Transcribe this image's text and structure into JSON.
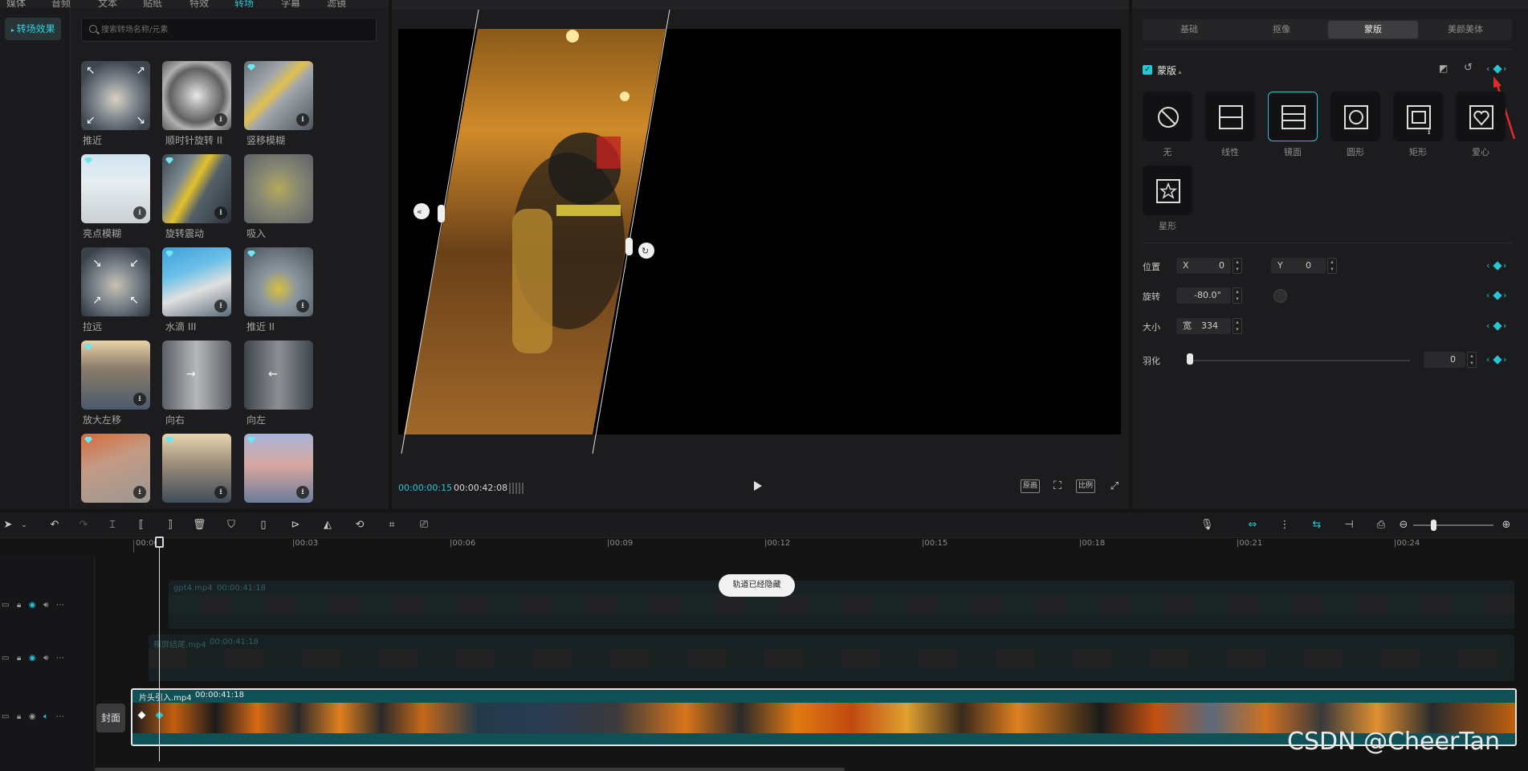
{
  "top_nav": {
    "items": [
      {
        "label": "媒体",
        "active": false
      },
      {
        "label": "音频",
        "active": false
      },
      {
        "label": "文本",
        "active": false
      },
      {
        "label": "贴纸",
        "active": false
      },
      {
        "label": "特效",
        "active": false
      },
      {
        "label": "转场",
        "active": true
      },
      {
        "label": "字幕",
        "active": false
      },
      {
        "label": "滤镜",
        "active": false
      }
    ]
  },
  "left_panel": {
    "category": "转场效果",
    "search_placeholder": "搜索转场名称/元素",
    "tiles": [
      {
        "label": "推近",
        "icon": "zoom-in-arrows",
        "download": false
      },
      {
        "label": "顺时针旋转 II",
        "icon": "spin-blur",
        "download": true
      },
      {
        "label": "竖移模糊",
        "icon": "vertical-blur",
        "download": true
      },
      {
        "label": "亮点模糊",
        "icon": "light-blur",
        "download": true
      },
      {
        "label": "旋转震动",
        "icon": "rotate-shake",
        "download": true
      },
      {
        "label": "吸入",
        "icon": "suck-in",
        "download": false
      },
      {
        "label": "拉远",
        "icon": "zoom-out-arrows",
        "download": false
      },
      {
        "label": "水滴 III",
        "icon": "water-drop",
        "download": true
      },
      {
        "label": "推近 II",
        "icon": "push-in",
        "download": true
      },
      {
        "label": "放大左移",
        "icon": "zoom-left",
        "download": true
      },
      {
        "label": "向右",
        "icon": "move-right",
        "download": false
      },
      {
        "label": "向左",
        "icon": "move-left",
        "download": false
      },
      {
        "label": "",
        "icon": "paper",
        "download": true
      },
      {
        "label": "",
        "icon": "street",
        "download": true
      },
      {
        "label": "",
        "icon": "sunset",
        "download": true
      }
    ]
  },
  "preview": {
    "time_current": "00:00:00:15",
    "time_total": "00:00:42:08",
    "buttons": {
      "quality": "原画",
      "ratio": "比例"
    }
  },
  "right_panel": {
    "tabs": [
      {
        "label": "基础",
        "active": false
      },
      {
        "label": "抠像",
        "active": false
      },
      {
        "label": "蒙版",
        "active": true
      },
      {
        "label": "美颜美体",
        "active": false
      }
    ],
    "mask_title": "蒙版",
    "shapes": [
      {
        "label": "无",
        "icon": "none-icon",
        "selected": false
      },
      {
        "label": "线性",
        "icon": "linear-icon",
        "selected": false
      },
      {
        "label": "镜面",
        "icon": "mirror-icon",
        "selected": true
      },
      {
        "label": "圆形",
        "icon": "circle-icon",
        "selected": false
      },
      {
        "label": "矩形",
        "icon": "rectangle-icon",
        "selected": false
      },
      {
        "label": "爱心",
        "icon": "heart-icon",
        "selected": false
      },
      {
        "label": "星形",
        "icon": "star-icon",
        "selected": false
      }
    ],
    "params": {
      "position_label": "位置",
      "x_label": "X",
      "x_value": "0",
      "y_label": "Y",
      "y_value": "0",
      "rotation_label": "旋转",
      "rotation_value": "-80.0°",
      "size_label": "大小",
      "width_label": "宽",
      "width_value": "334",
      "feather_label": "羽化",
      "feather_value": "0"
    }
  },
  "timeline": {
    "ticks": [
      "00:00",
      "|00:03",
      "|00:06",
      "|00:09",
      "|00:12",
      "|00:15",
      "|00:18",
      "|00:21",
      "|00:24"
    ],
    "tracks": [
      {
        "name": "gpt4.mp4",
        "duration": "00:00:41:18",
        "hidden": true
      },
      {
        "name": "横屏结尾.mp4",
        "duration": "00:00:41:18",
        "hidden": true
      },
      {
        "name": "片头引入.mp4",
        "duration": "00:00:41:18",
        "hidden": false
      }
    ],
    "cover_label": "封面",
    "toast": "轨道已经隐藏",
    "watermark": "CSDN @CheerTan"
  },
  "colors": {
    "accent": "#25c6d6",
    "background": "#141414",
    "panel": "#1c1c1e"
  }
}
